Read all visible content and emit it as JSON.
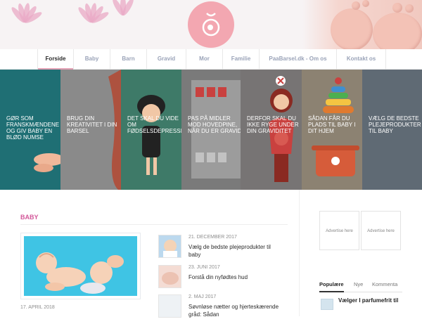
{
  "nav": {
    "items": [
      "Forside",
      "Baby",
      "Barn",
      "Gravid",
      "Mor",
      "Familie",
      "PaaBarsel.dk - Om os",
      "Kontakt os"
    ],
    "active": "Forside"
  },
  "slides": [
    {
      "title": "GØR SOM FRANSKMÆNDENE OG GIV BABY EN BLØD NUMSE",
      "color": "#1f6f74"
    },
    {
      "title": "BRUG DIN KREATIVITET I DIN BARSEL",
      "color": "#8a8a8a"
    },
    {
      "title": "DET SKAL DU VIDE OM FØDSELSDEPRESSION",
      "color": "#3e7a68"
    },
    {
      "title": "PAS PÅ MIDLER MOD HOVEDPINE, NÅR DU ER GRAVID",
      "color": "#7a7a7a"
    },
    {
      "title": "DERFOR SKAL DU IKKE RYGE UNDER DIN GRAVIDITET",
      "color": "#777474"
    },
    {
      "title": "SÅDAN FÅR DU PLADS TIL BABY I DIT HJEM",
      "color": "#8c8272"
    },
    {
      "title": "VÆLG DE BEDSTE PLEJEPRODUKTER TIL BABY",
      "color": "#5f6a74"
    }
  ],
  "section": {
    "title": "BABY"
  },
  "featured": {
    "date": "17. APRIL 2018"
  },
  "posts": [
    {
      "date": "21. DECEMBER 2017",
      "title": "Vælg de bedste plejeprodukter til baby"
    },
    {
      "date": "23. JUNI 2017",
      "title": "Forstå din nyfødtes hud"
    },
    {
      "date": "2. MAJ 2017",
      "title": "Søvnløse nætter og hjerteskærende gråd: Sådan"
    }
  ],
  "ads": [
    "Advertise here",
    "Advertise here"
  ],
  "sidebar": {
    "tabs": [
      "Populære",
      "Nye",
      "Kommenta"
    ],
    "active_tab": "Populære",
    "popular": [
      {
        "title": "Vælger I parfumefrit til"
      }
    ]
  },
  "colors": {
    "accent_pink": "#e3a0b4",
    "section_pink": "#d3589a",
    "logo_pink": "#f3a7b1"
  }
}
